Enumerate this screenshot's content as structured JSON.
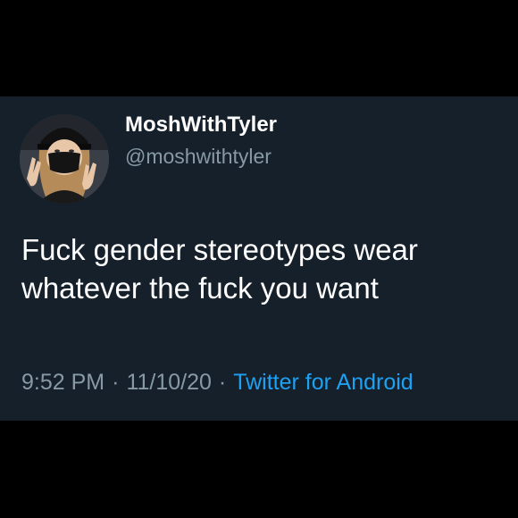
{
  "tweet": {
    "display_name": "MoshWithTyler",
    "handle": "@moshwithtyler",
    "text": "Fuck gender stereotypes wear whatever the fuck you want",
    "time": "9:52 PM",
    "date": "11/10/20",
    "separator": "·",
    "source": "Twitter for Android"
  },
  "colors": {
    "background": "#000000",
    "card": "#15202b",
    "text": "#ffffff",
    "secondary": "#8899a6",
    "link": "#1da1f2"
  }
}
